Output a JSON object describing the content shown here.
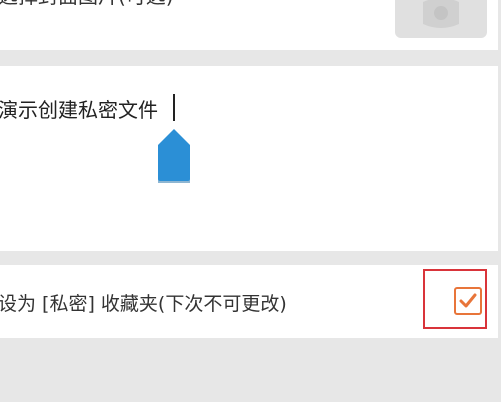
{
  "cover": {
    "label": "选择封面图片(可选)"
  },
  "name_input": {
    "value": "演示创建私密文件"
  },
  "private_option": {
    "label": "设为 [私密] 收藏夹(下次不可更改)",
    "checked": true
  },
  "colors": {
    "checkbox": "#e8753a",
    "highlight": "#d9343a",
    "cursor_handle": "#2b8fd6",
    "background": "#e7e7e7"
  },
  "icons": {
    "cover_thumb": "image-placeholder-icon",
    "checkbox": "checkmark-icon",
    "cursor": "text-cursor-handle-icon"
  }
}
